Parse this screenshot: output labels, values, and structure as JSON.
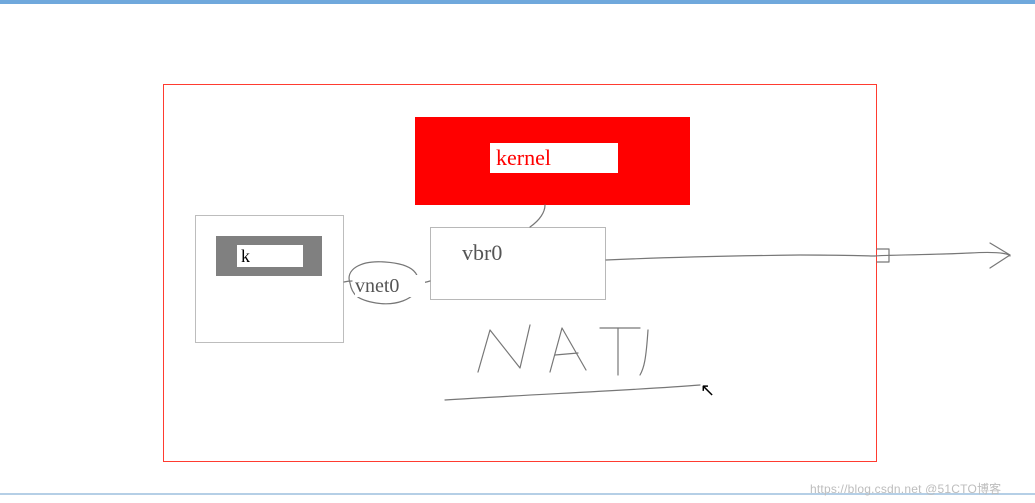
{
  "diagram": {
    "kernel_label": "kernel",
    "k_label": "k",
    "vbr_label": "vbr0",
    "vnet_label": "vnet0",
    "nat_annotation": "NAT"
  },
  "colors": {
    "frame": "#ff3b30",
    "kernel_bg": "#ff0000",
    "gray_bg": "#808080",
    "hand_stroke": "#777777"
  },
  "watermark": "https://blog.csdn.net @51CTO博客"
}
